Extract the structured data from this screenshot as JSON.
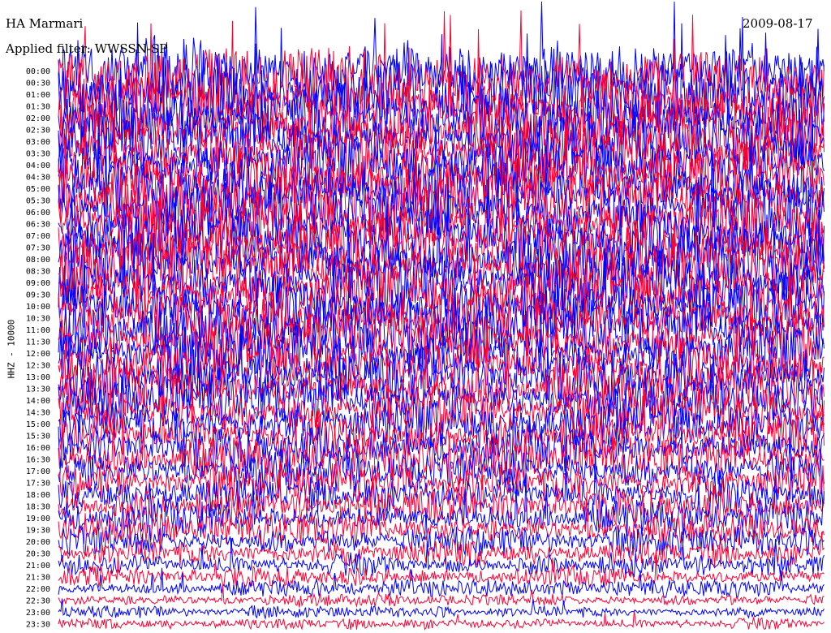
{
  "header": {
    "station": "HA Marmari",
    "date": "2009-08-17",
    "filter": "Applied filter: WWSSN-SP"
  },
  "chart_data": {
    "type": "line",
    "title": "HA Marmari",
    "ylabel": "HHZ - 10000",
    "trace_colors": [
      "#ff0033",
      "#0000ff"
    ],
    "row_labels": [
      "00:00",
      "00:30",
      "01:00",
      "01:30",
      "02:00",
      "02:30",
      "03:00",
      "03:30",
      "04:00",
      "04:30",
      "05:00",
      "05:30",
      "06:00",
      "06:30",
      "07:00",
      "07:30",
      "08:00",
      "08:30",
      "09:00",
      "09:30",
      "10:00",
      "10:30",
      "11:00",
      "11:30",
      "12:00",
      "12:30",
      "13:00",
      "13:30",
      "14:00",
      "14:30",
      "15:00",
      "15:30",
      "16:00",
      "16:30",
      "17:00",
      "17:30",
      "18:00",
      "18:30",
      "19:00",
      "19:30",
      "20:00",
      "20:30",
      "21:00",
      "21:30",
      "22:00",
      "22:30",
      "23:00",
      "23:30"
    ],
    "row_color_pattern": [
      "#0000ff",
      "#ff0033"
    ],
    "relative_amplitude": [
      1.0,
      1.0,
      1.0,
      1.0,
      1.0,
      1.0,
      1.0,
      1.0,
      1.0,
      1.0,
      1.0,
      1.0,
      1.0,
      1.0,
      1.0,
      1.0,
      1.0,
      1.0,
      1.0,
      1.0,
      0.95,
      0.95,
      0.9,
      0.9,
      0.9,
      0.85,
      0.85,
      0.8,
      0.8,
      0.75,
      0.75,
      0.7,
      0.7,
      0.65,
      0.65,
      0.6,
      0.6,
      0.55,
      0.55,
      0.5,
      0.45,
      0.4,
      0.35,
      0.3,
      0.25,
      0.2,
      0.18,
      0.18
    ]
  }
}
